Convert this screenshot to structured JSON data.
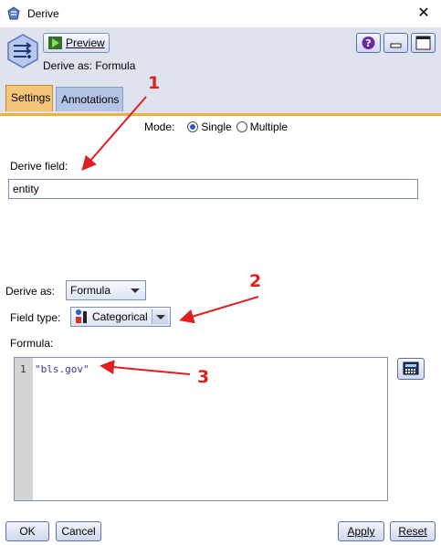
{
  "window": {
    "title": "Derive"
  },
  "header": {
    "preview_label": "Preview",
    "derive_as_text": "Derive as: Formula"
  },
  "tabs": [
    {
      "label": "Settings",
      "active": true
    },
    {
      "label": "Annotations",
      "active": false
    }
  ],
  "mode": {
    "label": "Mode:",
    "options": [
      {
        "label": "Single",
        "selected": true
      },
      {
        "label": "Multiple",
        "selected": false
      }
    ]
  },
  "derive_field": {
    "label": "Derive field:",
    "value": "entity"
  },
  "derive_as": {
    "label": "Derive as:",
    "value": "Formula"
  },
  "field_type": {
    "label": "Field type:",
    "value": "Categorical"
  },
  "formula": {
    "label": "Formula:",
    "line_number": "1",
    "code": "\"bls.gov\""
  },
  "footer": {
    "ok_label": "OK",
    "cancel_label": "Cancel",
    "apply_label": "Apply",
    "reset_label": "Reset"
  },
  "annotations": {
    "one": "1",
    "two": "2",
    "three": "3"
  },
  "colors": {
    "accent_tab": "#f5c67a",
    "header_bg": "#dfe3ee",
    "annotation_red": "#e02020"
  }
}
